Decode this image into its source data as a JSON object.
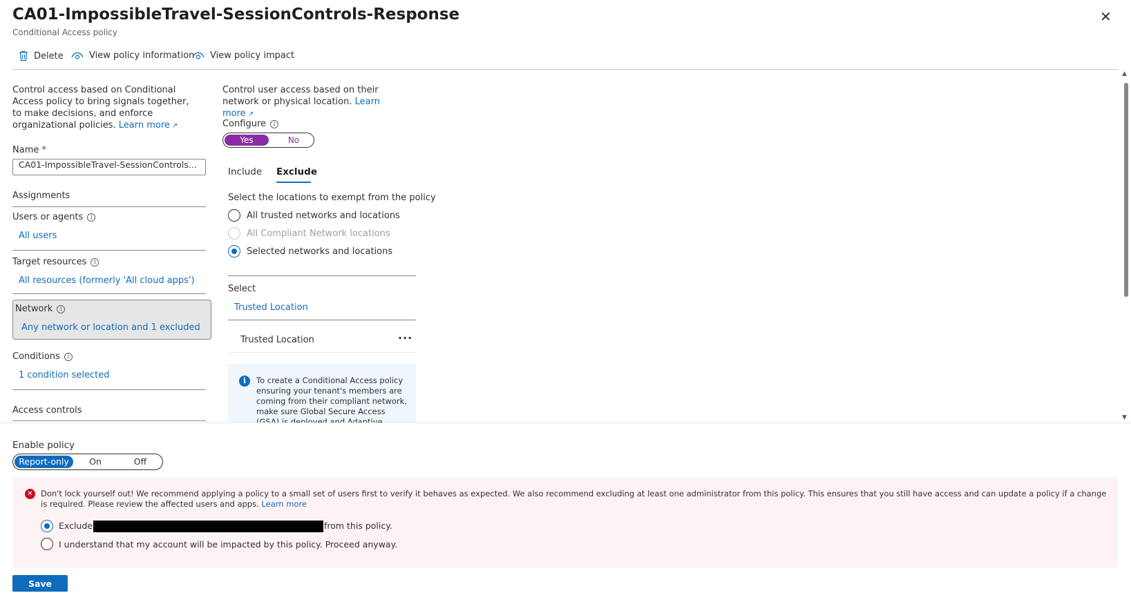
{
  "header": {
    "title": "CA01-ImpossibleTravel-SessionControls-Response",
    "subtitle": "Conditional Access policy",
    "more_label": "···",
    "close_label": "✕"
  },
  "toolbar": {
    "delete_label": "Delete",
    "view_info_label": "View policy information",
    "view_impact_label": "View policy impact"
  },
  "left": {
    "description": "Control access based on Conditional Access policy to bring signals together, to make decisions, and enforce organizational policies.",
    "learn_more": "Learn more",
    "name_label": "Name",
    "required_mark": "*",
    "name_value": "CA01-ImpossibleTravel-SessionControls-Res...",
    "assignments_heading": "Assignments",
    "users_label": "Users or agents",
    "users_value": "All users",
    "target_label": "Target resources",
    "target_value": "All resources (formerly 'All cloud apps')",
    "network_label": "Network",
    "network_value": "Any network or location and 1 excluded",
    "conditions_label": "Conditions",
    "conditions_value": "1 condition selected",
    "access_controls_heading": "Access controls"
  },
  "middle": {
    "description": "Control user access based on their network or physical location.",
    "learn_more": "Learn more",
    "configure_label": "Configure",
    "configure_yes": "Yes",
    "configure_no": "No",
    "tabs": [
      {
        "label": "Include",
        "selected": false
      },
      {
        "label": "Exclude",
        "selected": true
      }
    ],
    "select_prompt": "Select the locations to exempt from the policy",
    "options": [
      {
        "label": "All trusted networks and locations",
        "checked": false,
        "disabled": false
      },
      {
        "label": "All Compliant Network locations",
        "checked": false,
        "disabled": true
      },
      {
        "label": "Selected networks and locations",
        "checked": true,
        "disabled": false
      }
    ],
    "select_label": "Select",
    "select_link": "Trusted Location",
    "selected_items": [
      {
        "label": "Trusted Location",
        "more": "···"
      }
    ],
    "info_icon": "i",
    "info_text": "To create a Conditional Access policy ensuring your tenant's members are coming from their compliant network, make sure Global Secure Access (GSA) is deployed and Adaptive Access Signaling"
  },
  "bottom": {
    "enable_label": "Enable policy",
    "enable_options": [
      "Report-only",
      "On",
      "Off"
    ],
    "enable_selected": "Report-only",
    "warning_text": "Don't lock yourself out! We recommend applying a policy to a small set of users first to verify it behaves as expected. We also recommend excluding at least one administrator from this policy. This ensures that you still have access and can update a policy if a change is required. Please review the affected users and apps.",
    "warning_learn_more": "Learn more",
    "exclude_prefix": "Exclude",
    "exclude_suffix": "from this policy.",
    "understand_label": "I understand that my account will be impacted by this policy. Proceed anyway.",
    "save_label": "Save"
  },
  "colors": {
    "link": "#0f6cbd",
    "configure_accent": "#8a2da5",
    "warning_bg": "#fdf3f4",
    "error_icon": "#c50f1f",
    "info_bg": "#eff6fc"
  },
  "icons": {
    "delete": "trash-icon",
    "view_info": "eye-icon",
    "view_impact": "eye-icon",
    "close": "close-icon",
    "info": "info-icon",
    "error": "error-icon",
    "external": "external-link-icon"
  }
}
